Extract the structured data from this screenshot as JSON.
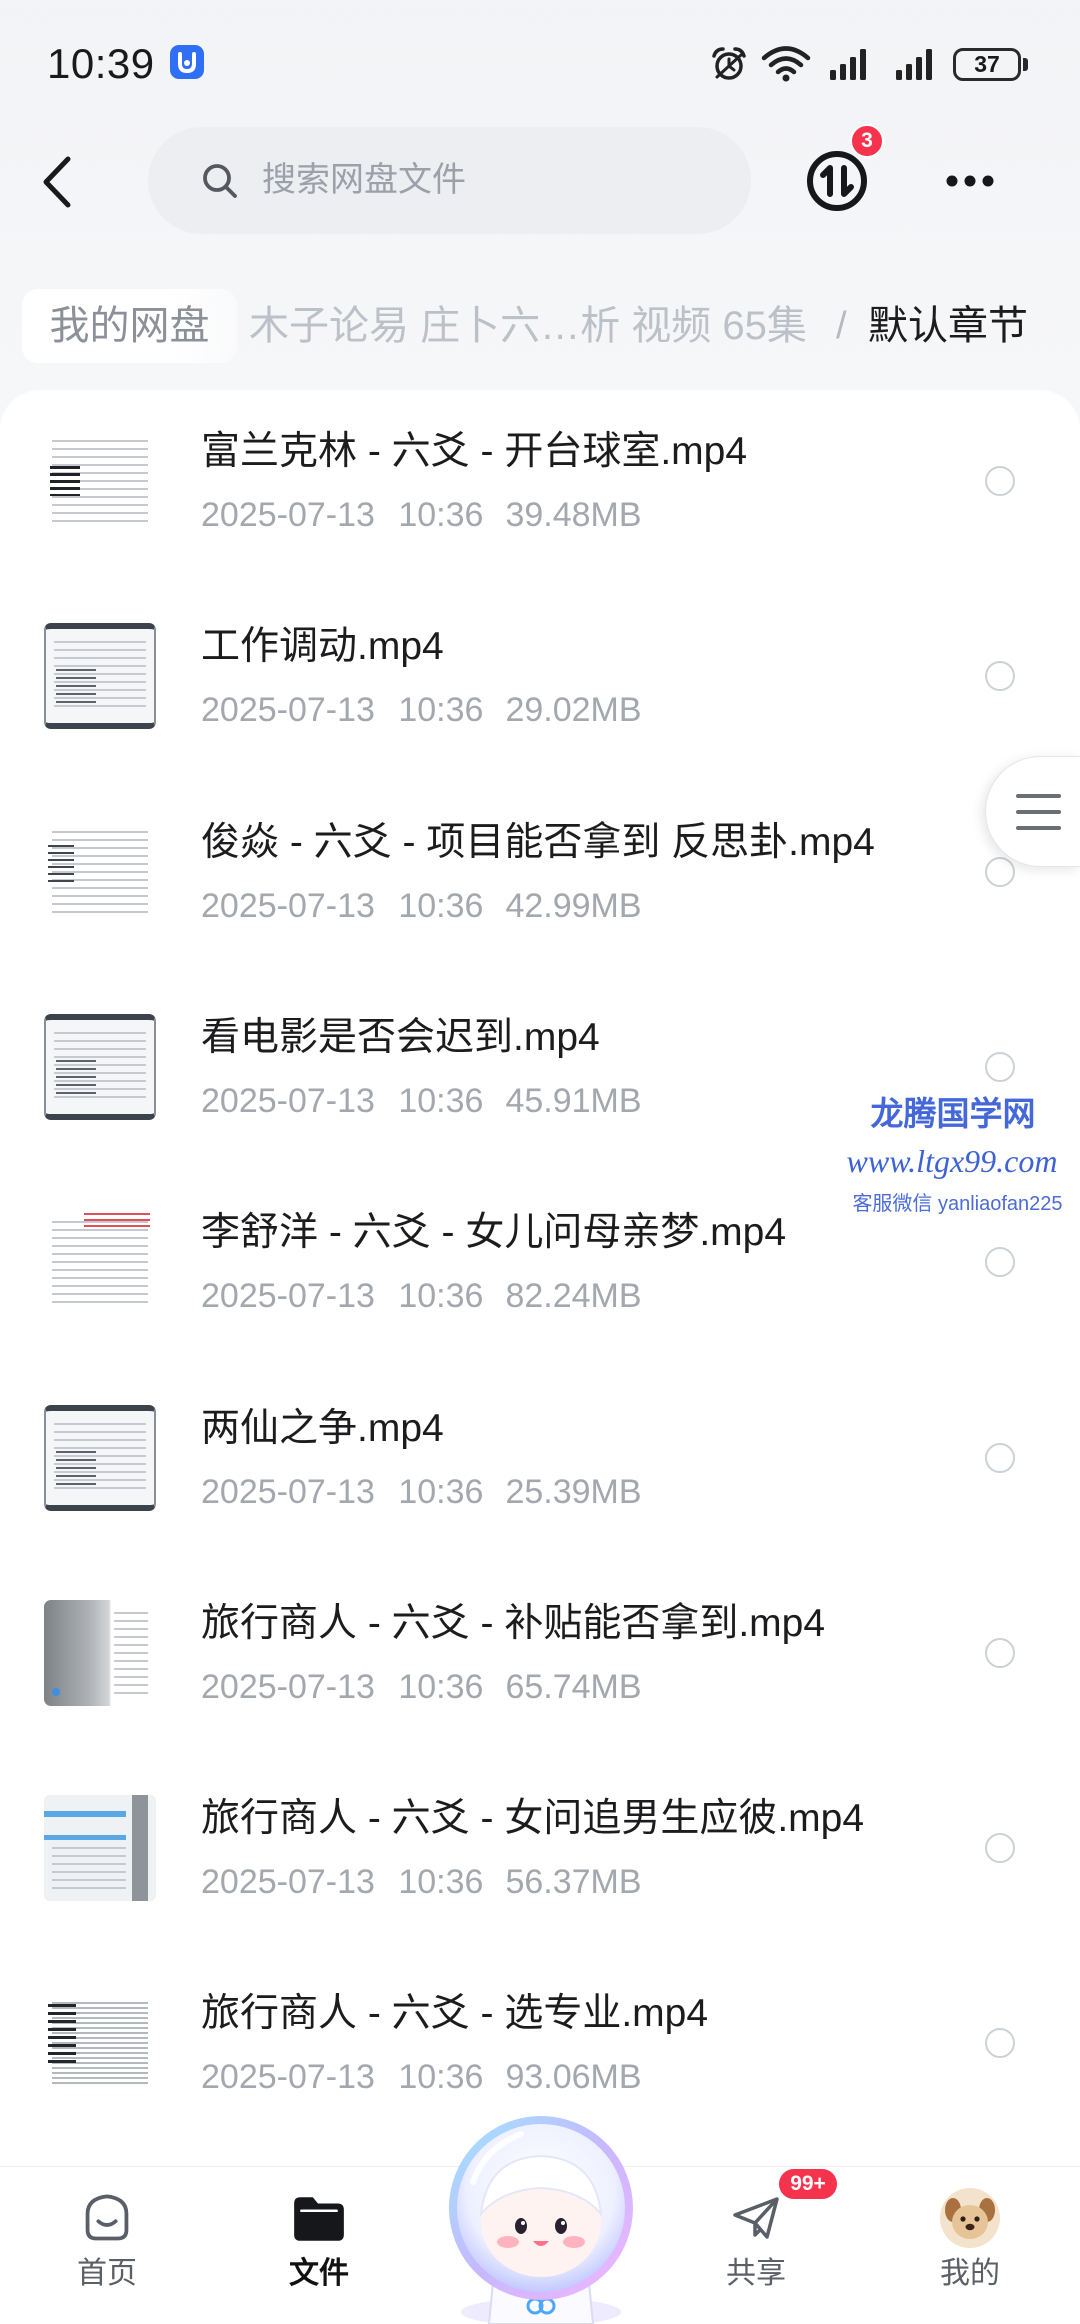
{
  "status_bar": {
    "time": "10:39",
    "battery": "37",
    "icons": [
      "app-notification-icon",
      "alarm-icon",
      "wifi-icon",
      "signal-icon",
      "signal-icon",
      "battery-icon"
    ]
  },
  "header": {
    "back_icon": "chevron-left-icon",
    "search": {
      "placeholder": "搜索网盘文件",
      "icon": "search-icon"
    },
    "transfer": {
      "icon": "transfer-icon",
      "badge": "3"
    },
    "more_icon": "more-dots-icon"
  },
  "breadcrumb": {
    "root": "我的网盘",
    "folder": "木子论易 庄卜六…析 视频 65集",
    "separator": "/",
    "current": "默认章节"
  },
  "files": [
    {
      "name": "富兰克林 - 六爻 - 开台球室.mp4",
      "modified": "2025-07-13 10:36",
      "size": "39.48MB"
    },
    {
      "name": "工作调动.mp4",
      "modified": "2025-07-13 10:36",
      "size": "29.02MB"
    },
    {
      "name": "俊焱 - 六爻 - 项目能否拿到 反思卦.mp4",
      "modified": "2025-07-13 10:36",
      "size": "42.99MB"
    },
    {
      "name": "看电影是否会迟到.mp4",
      "modified": "2025-07-13 10:36",
      "size": "45.91MB"
    },
    {
      "name": "李舒洋 - 六爻 - 女儿问母亲梦.mp4",
      "modified": "2025-07-13 10:36",
      "size": "82.24MB"
    },
    {
      "name": "两仙之争.mp4",
      "modified": "2025-07-13 10:36",
      "size": "25.39MB"
    },
    {
      "name": "旅行商人 - 六爻 - 补贴能否拿到.mp4",
      "modified": "2025-07-13 10:36",
      "size": "65.74MB"
    },
    {
      "name": "旅行商人 - 六爻 - 女问追男生应彼.mp4",
      "modified": "2025-07-13 10:36",
      "size": "56.37MB"
    },
    {
      "name": "旅行商人 - 六爻 - 选专业.mp4",
      "modified": "2025-07-13 10:36",
      "size": "93.06MB"
    }
  ],
  "side_handle": {
    "icon": "menu-lines-icon"
  },
  "watermark": {
    "title": "龙腾国学网",
    "url": "www.ltgx99.com",
    "contact": "客服微信 yanliaofan225"
  },
  "bottom_nav": {
    "items": [
      {
        "label": "首页",
        "icon": "home-smile-icon",
        "active": false
      },
      {
        "label": "文件",
        "icon": "folder-icon",
        "active": true
      },
      {
        "label": "共享",
        "icon": "paper-plane-icon",
        "active": false,
        "badge": "99+"
      },
      {
        "label": "我的",
        "icon": "avatar-icon",
        "active": false
      }
    ],
    "center": {
      "icon": "assistant-mascot-icon"
    }
  },
  "colors": {
    "badge_red": "#f5334d",
    "watermark_blue": "#4468d9",
    "text_primary": "#1c1c1e",
    "text_secondary": "#a3a7ae",
    "app_icon_blue": "#2f6ff5"
  }
}
